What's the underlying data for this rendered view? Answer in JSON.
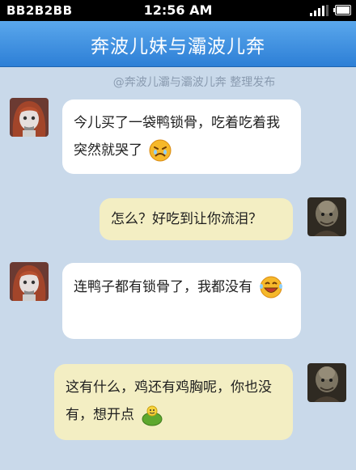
{
  "status_bar": {
    "carrier": "BB2B2BB",
    "time": "12:56 AM"
  },
  "header": {
    "title": "奔波儿妹与灞波儿奔"
  },
  "credit": "@奔波儿灞与灞波儿奔 整理发布",
  "messages": [
    {
      "sender": "girl",
      "direction": "incoming",
      "text": "今儿买了一袋鸭锁骨，吃着吃着我突然就哭了",
      "emoji": "crying-face-icon"
    },
    {
      "sender": "monster",
      "direction": "outgoing",
      "text": "怎么？好吃到让你流泪？"
    },
    {
      "sender": "girl",
      "direction": "incoming",
      "text": "连鸭子都有锁骨了，我都没有",
      "emoji": "laughing-face-icon"
    },
    {
      "sender": "monster",
      "direction": "outgoing",
      "text": "这有什么，鸡还有鸡胸呢，你也没有，想开点",
      "emoji": "pig-icon"
    }
  ],
  "colors": {
    "header": "#3b8ee0",
    "background": "#c9d9ea",
    "incoming_bubble": "#ffffff",
    "outgoing_bubble": "#f3eec3"
  }
}
